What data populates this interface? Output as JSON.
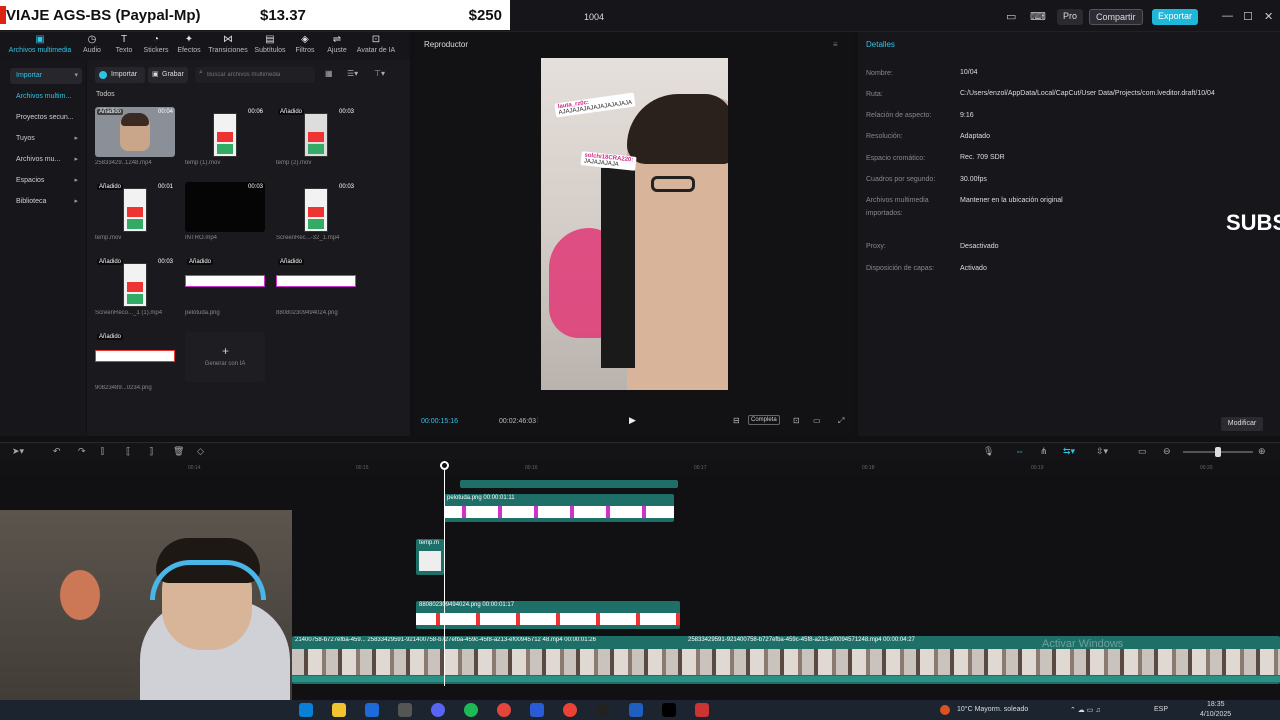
{
  "donation": {
    "alert": "VIAJE AGS-BS (Paypal-Mp)",
    "current": "$13.37",
    "goal": "$250"
  },
  "window": {
    "project_title": "1004",
    "pro": "Pro",
    "share": "Compartir",
    "export": "Exportar"
  },
  "toolbar": {
    "items": [
      {
        "label": "Archivos multimedia",
        "icon": "media-icon"
      },
      {
        "label": "Audio",
        "icon": "audio-icon"
      },
      {
        "label": "Texto",
        "icon": "text-icon"
      },
      {
        "label": "Stickers",
        "icon": "sticker-icon"
      },
      {
        "label": "Efectos",
        "icon": "effects-icon"
      },
      {
        "label": "Transiciones",
        "icon": "transitions-icon"
      },
      {
        "label": "Subtítulos",
        "icon": "subtitles-icon"
      },
      {
        "label": "Filtros",
        "icon": "filters-icon"
      },
      {
        "label": "Ajuste",
        "icon": "adjust-icon"
      },
      {
        "label": "Avatar de IA",
        "icon": "ai-avatar-icon"
      }
    ]
  },
  "leftnav": {
    "items": [
      {
        "label": "Importar"
      },
      {
        "label": "Archivos multim..."
      },
      {
        "label": "Proyectos secun..."
      },
      {
        "label": "Tuyos"
      },
      {
        "label": "Archivos mu..."
      },
      {
        "label": "Espacios"
      },
      {
        "label": "Biblioteca"
      }
    ]
  },
  "media": {
    "import": "Importar",
    "record": "Grabar",
    "search_placeholder": "Buscar archivos multimedia",
    "all_label": "Todos",
    "clips": [
      {
        "name": "25833429..1248.mp4",
        "badge": "Añadido",
        "duration": "00:04"
      },
      {
        "name": "temp (1).mov",
        "badge": "",
        "duration": "00:06"
      },
      {
        "name": "temp (2).mov",
        "badge": "Añadido",
        "duration": "00:03"
      },
      {
        "name": "temp.mov",
        "badge": "Añadido",
        "duration": "00:01"
      },
      {
        "name": "INTRO.mp4",
        "badge": "",
        "duration": "00:03"
      },
      {
        "name": "ScreenRec...-32_1.mp4",
        "badge": "",
        "duration": "00:03"
      },
      {
        "name": "ScreenReco..._1 (1).mp4",
        "badge": "Añadido",
        "duration": "00:03"
      },
      {
        "name": "pelotuda.png",
        "badge": "Añadido",
        "duration": ""
      },
      {
        "name": "880802309494024.png",
        "badge": "Añadido",
        "duration": ""
      },
      {
        "name": "90823489...0234.png",
        "badge": "Añadido",
        "duration": ""
      }
    ],
    "generate": "Generar con IA"
  },
  "player": {
    "title": "Reproductor",
    "current_time": "00:00:15:16",
    "total_time": "00:02:46:03",
    "full_label": "Completa",
    "chat": [
      {
        "user": "lauta_rz0c:",
        "msg": "AJAJAJAJAJAJAJAJAJAJA"
      },
      {
        "user": "solchi18CRA220:",
        "msg": "JAJAJAJAJA"
      }
    ]
  },
  "details": {
    "title": "Detalles",
    "rows": [
      {
        "label": "Nombre:",
        "value": "10/04"
      },
      {
        "label": "Ruta:",
        "value": "C:/Users/enzol/AppData/Local/CapCut/User Data/Projects/com.lveditor.draft/10/04"
      },
      {
        "label": "Relación de aspecto:",
        "value": "9:16"
      },
      {
        "label": "Resolución:",
        "value": "Adaptado"
      },
      {
        "label": "Espacio cromático:",
        "value": "Rec. 709 SDR"
      },
      {
        "label": "Cuadros por segundo:",
        "value": "30.00fps"
      },
      {
        "label": "Archivos multimedia importados:",
        "value": "Mantener en la ubicación original"
      },
      {
        "label": "Proxy:",
        "value": "Desactivado"
      },
      {
        "label": "Disposición de capas:",
        "value": "Activado"
      }
    ],
    "modify": "Modificar",
    "subs_overlay": "SUBS"
  },
  "timeline": {
    "ruler": [
      "00:14",
      "00:15",
      "00:16",
      "00:17",
      "00:18",
      "00:19",
      "00:20"
    ],
    "clips": [
      {
        "label": "pelotuda.png  00:00:01:11"
      },
      {
        "label": "temp.m"
      },
      {
        "label": "880802309494024.png  00:00:01:17"
      },
      {
        "label": "21400758-b727efba-459...  25833429591-921400758-b727efba-459c-45f8-a213-ef00945712 48.mp4  00:00:01:26"
      },
      {
        "label": "25833429591-921400758-b727efba-459c-45f8-a213-ef0094571248.mp4  00:00:04:27"
      }
    ],
    "watermark": "Activar Windows"
  },
  "taskbar": {
    "weather": "10°C  Mayorm. soleado",
    "lang": "ESP",
    "time": "18:35",
    "date": "4/10/2025"
  }
}
